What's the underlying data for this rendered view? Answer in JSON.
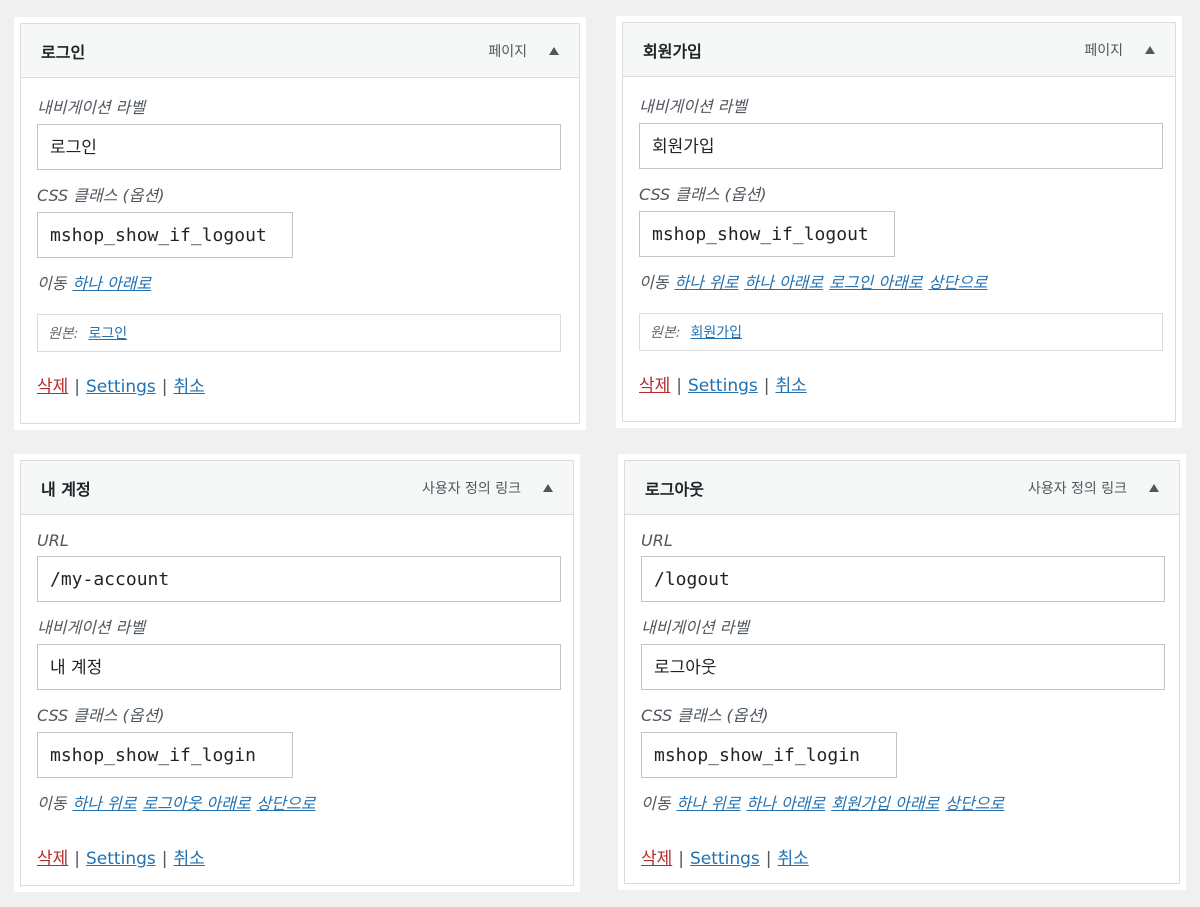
{
  "panels": [
    {
      "title": "로그인",
      "type": "페이지",
      "nav_label_caption": "내비게이션 라벨",
      "nav_label_value": "로그인",
      "css_caption": "CSS 클래스 (옵션)",
      "css_value": "mshop_show_if_logout",
      "move_caption": "이동",
      "move_links": [
        "하나 아래로"
      ],
      "original_caption": "원본:",
      "original_link": "로그인",
      "delete_label": "삭제",
      "settings_label": "Settings",
      "cancel_label": "취소",
      "separator": "|"
    },
    {
      "title": "회원가입",
      "type": "페이지",
      "nav_label_caption": "내비게이션 라벨",
      "nav_label_value": "회원가입",
      "css_caption": "CSS 클래스 (옵션)",
      "css_value": "mshop_show_if_logout",
      "move_caption": "이동",
      "move_links": [
        "하나 위로",
        "하나 아래로",
        "로그인 아래로",
        "상단으로"
      ],
      "original_caption": "원본:",
      "original_link": "회원가입",
      "delete_label": "삭제",
      "settings_label": "Settings",
      "cancel_label": "취소",
      "separator": "|"
    },
    {
      "title": "내 계정",
      "type": "사용자 정의 링크",
      "url_caption": "URL",
      "url_value": "/my-account",
      "nav_label_caption": "내비게이션 라벨",
      "nav_label_value": "내 계정",
      "css_caption": "CSS 클래스 (옵션)",
      "css_value": "mshop_show_if_login",
      "move_caption": "이동",
      "move_links": [
        "하나 위로",
        "로그아웃 아래로",
        "상단으로"
      ],
      "delete_label": "삭제",
      "settings_label": "Settings",
      "cancel_label": "취소",
      "separator": "|"
    },
    {
      "title": "로그아웃",
      "type": "사용자 정의 링크",
      "url_caption": "URL",
      "url_value": "/logout",
      "nav_label_caption": "내비게이션 라벨",
      "nav_label_value": "로그아웃",
      "css_caption": "CSS 클래스 (옵션)",
      "css_value": "mshop_show_if_login",
      "move_caption": "이동",
      "move_links": [
        "하나 위로",
        "하나 아래로",
        "회원가입 아래로",
        "상단으로"
      ],
      "delete_label": "삭제",
      "settings_label": "Settings",
      "cancel_label": "취소",
      "separator": "|"
    }
  ],
  "colors": {
    "link": "#2271b1",
    "delete": "#b32d2e",
    "background": "#f0f0f1"
  }
}
